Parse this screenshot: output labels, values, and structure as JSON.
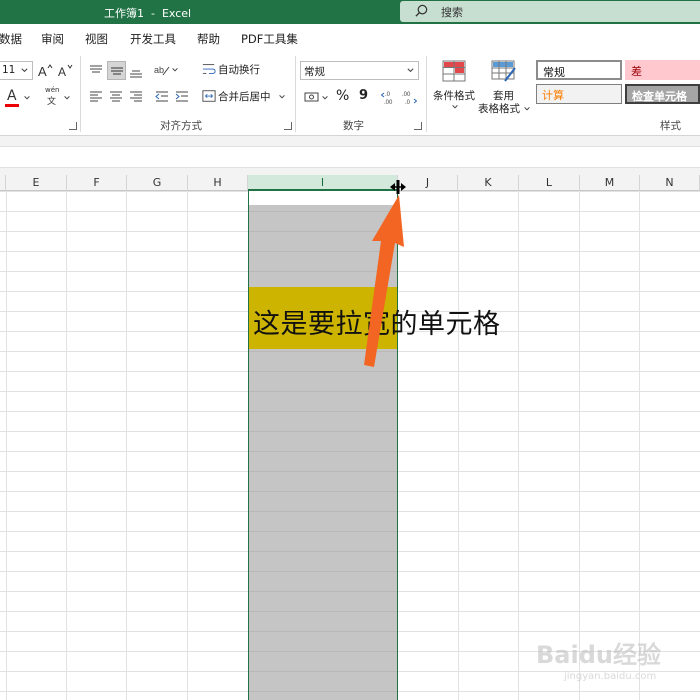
{
  "titlebar": {
    "title": "工作簿1  -  Excel",
    "search_label": "搜索"
  },
  "menu": {
    "tabs": [
      "数据",
      "审阅",
      "视图",
      "开发工具",
      "帮助",
      "PDF工具集"
    ]
  },
  "ribbon": {
    "font": {
      "size": "11",
      "underline_letter": "A",
      "phonetic_top": "wén",
      "phonetic_bottom": "文"
    },
    "alignment": {
      "wrap_text": "自动换行",
      "merge_center": "合并后居中",
      "group_label": "对齐方式"
    },
    "number": {
      "format": "常规",
      "percent": "%",
      "comma": "9",
      "group_label": "数字"
    },
    "styles": {
      "conditional_format": "条件格式",
      "format_table_line1": "套用",
      "format_table_line2": "表格格式",
      "cell_styles": [
        "常规",
        "差",
        "计算",
        "检查单元格"
      ],
      "group_label": "样式"
    }
  },
  "grid": {
    "columns": [
      "E",
      "F",
      "G",
      "H",
      "I",
      "J",
      "K",
      "L",
      "M",
      "N"
    ],
    "selected_column": "I",
    "cell_text": "这是要拉宽的单元格",
    "highlight_color": "#ccb400",
    "selection_color": "#c5c5c5",
    "accent": "#217346"
  },
  "watermark": {
    "main": "Baidu经验",
    "sub": "jingyan.baidu.com"
  }
}
